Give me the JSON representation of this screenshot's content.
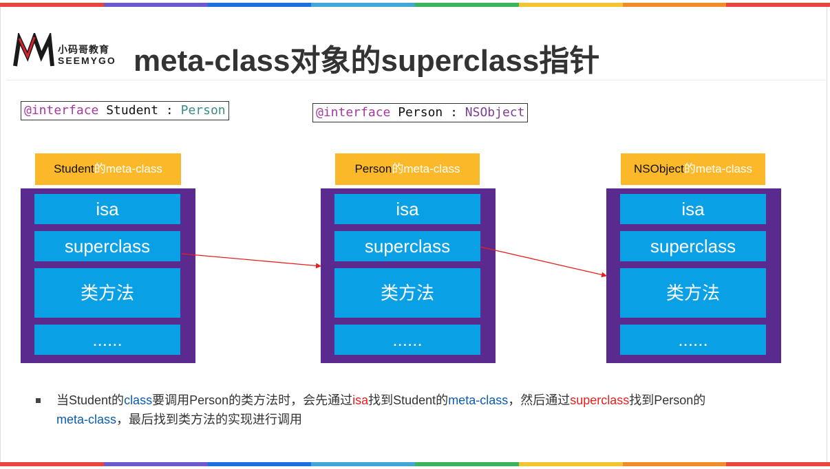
{
  "stripe_colors": [
    "#e8453c",
    "#6a5acd",
    "#1e6fe0",
    "#41a6d8",
    "#3cb55a",
    "#f4c430",
    "#f28c28",
    "#e8453c"
  ],
  "logo": {
    "cn": "小码哥教育",
    "en": "SEEMYGO"
  },
  "title": "meta-class对象的superclass指针",
  "code": {
    "student": {
      "kw": "@interface",
      "name": "Student",
      "colon": ":",
      "super": "Person"
    },
    "person": {
      "kw": "@interface",
      "name": "Person",
      "colon": ":",
      "super": "NSObject"
    }
  },
  "metaclasses": [
    {
      "class_name": "Student",
      "suffix": "的meta-class",
      "isa": "isa",
      "superclass": "superclass",
      "methods": "类方法",
      "more": "......"
    },
    {
      "class_name": "Person",
      "suffix": "的meta-class",
      "isa": "isa",
      "superclass": "superclass",
      "methods": "类方法",
      "more": "......"
    },
    {
      "class_name": "NSObject",
      "suffix": "的meta-class",
      "isa": "isa",
      "superclass": "superclass",
      "methods": "类方法",
      "more": "......"
    }
  ],
  "colors": {
    "label_bg": "#fbb829",
    "box_bg": "#5b2a8f",
    "cell_bg": "#0aa0e6",
    "arrow": "#e5201d",
    "highlight_blue": "#0b5cad",
    "highlight_red": "#e5201d"
  },
  "note": {
    "p1": "当Student的",
    "h1": "class",
    "p2": "要调用Person的类方法时，会先通过",
    "h2": "isa",
    "p3": "找到Student的",
    "h3": "meta-class",
    "p4": "，然后通过",
    "h4": "superclass",
    "p5": "找到Person的",
    "h5": "meta-class",
    "p6": "，最后找到类方法的实现进行调用"
  }
}
